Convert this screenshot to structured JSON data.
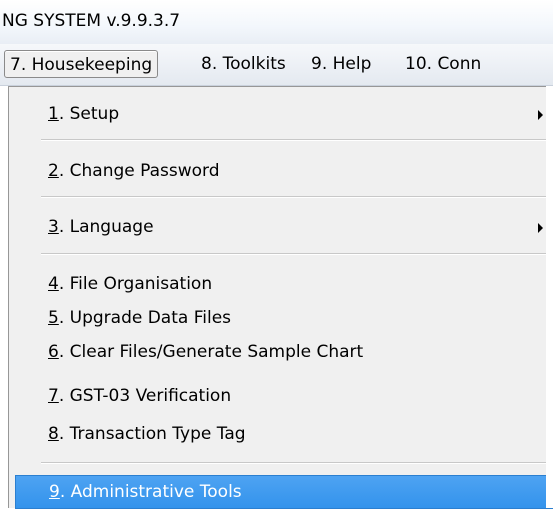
{
  "window": {
    "title": "NG SYSTEM v.9.9.3.7"
  },
  "menubar": {
    "items": [
      {
        "label": "7. Housekeeping",
        "open": true
      },
      {
        "label": "8. Toolkits"
      },
      {
        "label": "9. Help"
      },
      {
        "label": "10. Conn"
      }
    ]
  },
  "housekeeping_menu": {
    "items": [
      {
        "key": "1",
        "label": ". Setup",
        "submenu": true
      },
      {
        "key": "2",
        "label": ". Change Password"
      },
      {
        "key": "3",
        "label": ". Language",
        "submenu": true
      },
      {
        "key": "4",
        "label": ". File Organisation"
      },
      {
        "key": "5",
        "label": ". Upgrade Data Files"
      },
      {
        "key": "6",
        "label": ". Clear Files/Generate Sample Chart"
      },
      {
        "key": "7",
        "label": ". GST-03 Verification"
      },
      {
        "key": "8",
        "label": ". Transaction Type Tag"
      },
      {
        "key": "9",
        "label": ". Administrative Tools",
        "highlighted": true
      }
    ]
  }
}
